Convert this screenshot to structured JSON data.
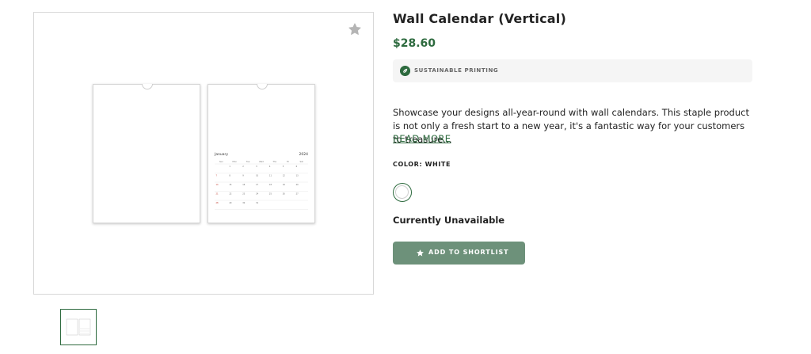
{
  "gallery": {
    "favorite_icon": "star-icon",
    "calendar_preview": {
      "month": "January",
      "year": "2024",
      "weekdays": [
        "Sun",
        "Mon",
        "Tue",
        "Wed",
        "Thu",
        "Fri",
        "Sat"
      ]
    }
  },
  "product": {
    "title": "Wall Calendar (Vertical)",
    "price": "$28.60",
    "badge": {
      "icon": "leaf-icon",
      "label": "SUSTAINABLE PRINTING"
    },
    "description": "Showcase your designs all-year-round with wall calendars. This staple product is not only a fresh start to a new year, it's a fantastic way for your customers to treasure…",
    "read_more": "READ MORE",
    "color_label": "COLOR: WHITE",
    "color_swatch": "#ffffff",
    "availability": "Currently Unavailable",
    "shortlist_button": {
      "icon": "star-icon",
      "label": "ADD TO SHORTLIST"
    }
  },
  "theme": {
    "accent": "#2d6a3e",
    "button": "#6d917a",
    "badge_bg": "#f5f5f5"
  }
}
